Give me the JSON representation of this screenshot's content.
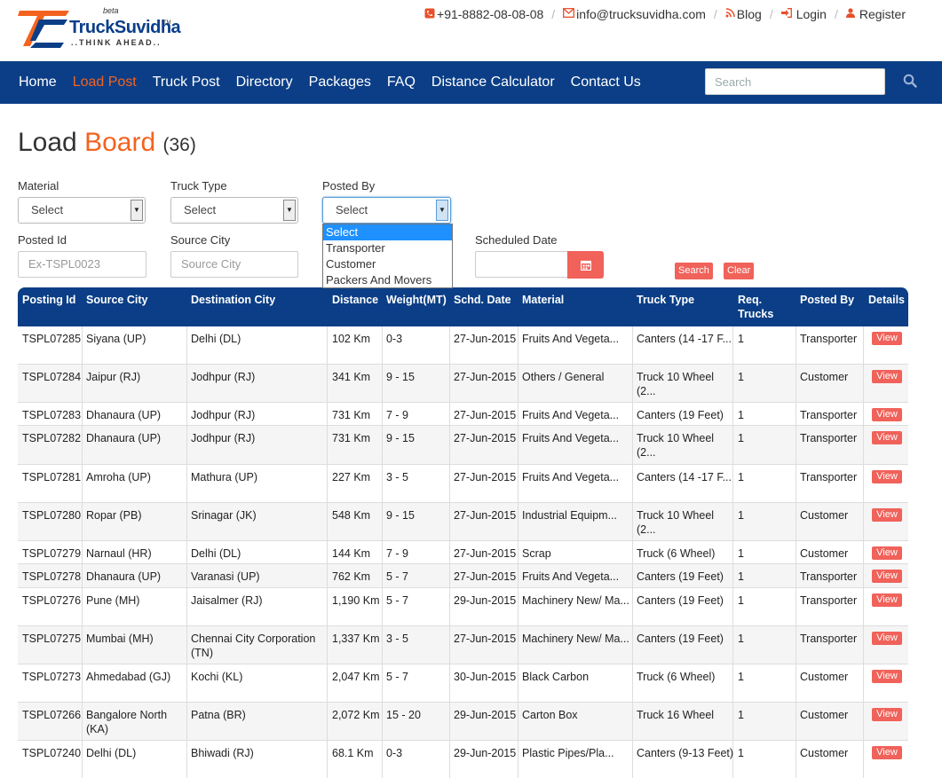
{
  "logo": {
    "brand": "TruckSuvidha",
    "tag": "..THINK AHEAD..",
    "beta": "beta",
    "tm": "TM"
  },
  "contact": {
    "phone": "+91-8882-08-08-08",
    "email": "info@trucksuvidha.com",
    "blog": "Blog",
    "login": "Login",
    "register": "Register"
  },
  "nav": {
    "items": [
      "Home",
      "Load Post",
      "Truck Post",
      "Directory",
      "Packages",
      "FAQ",
      "Distance Calculator",
      "Contact Us"
    ],
    "search_placeholder": "Search"
  },
  "heading": {
    "part1": "Load",
    "part2": "Board",
    "count": "(36)"
  },
  "filters": {
    "material_label": "Material",
    "material_value": "Select",
    "truck_type_label": "Truck Type",
    "truck_type_value": "Select",
    "posted_by_label": "Posted By",
    "posted_by_value": "Select",
    "posted_by_options": [
      "Select",
      "Transporter",
      "Customer",
      "Packers And Movers"
    ],
    "posted_id_label": "Posted Id",
    "posted_id_placeholder": "Ex-TSPL0023",
    "source_city_label": "Source City",
    "source_city_placeholder": "Source City",
    "scheduled_date_label": "Scheduled Date",
    "search_button": "Search",
    "clear_button": "Clear"
  },
  "table": {
    "headers": [
      "Posting Id",
      "Source City",
      "Destination City",
      "Distance",
      "Weight(MT)",
      "Schd. Date",
      "Material",
      "Truck Type",
      "Req. Trucks",
      "Posted By",
      "Details"
    ],
    "view_label": "View",
    "rows": [
      [
        "TSPL07285",
        "Siyana (UP)",
        "Delhi (DL)",
        "102 Km",
        "0-3",
        "27-Jun-2015",
        "Fruits And Vegeta...",
        "Canters (14 -17 F...",
        "1",
        "Transporter"
      ],
      [
        "TSPL07284",
        "Jaipur (RJ)",
        "Jodhpur (RJ)",
        "341 Km",
        "9 - 15",
        "27-Jun-2015",
        "Others / General",
        "Truck 10 Wheel (2...",
        "1",
        "Customer"
      ],
      [
        "TSPL07283",
        "Dhanaura (UP)",
        "Jodhpur (RJ)",
        "731 Km",
        "7 - 9",
        "27-Jun-2015",
        "Fruits And Vegeta...",
        "Canters (19 Feet)",
        "1",
        "Transporter"
      ],
      [
        "TSPL07282",
        "Dhanaura (UP)",
        "Jodhpur (RJ)",
        "731 Km",
        "9 - 15",
        "27-Jun-2015",
        "Fruits And Vegeta...",
        "Truck 10 Wheel (2...",
        "1",
        "Transporter"
      ],
      [
        "TSPL07281",
        "Amroha (UP)",
        "Mathura (UP)",
        "227 Km",
        "3 - 5",
        "27-Jun-2015",
        "Fruits And Vegeta...",
        "Canters (14 -17 F...",
        "1",
        "Transporter"
      ],
      [
        "TSPL07280",
        "Ropar (PB)",
        "Srinagar (JK)",
        "548 Km",
        "9 - 15",
        "27-Jun-2015",
        "Industrial Equipm...",
        "Truck 10 Wheel (2...",
        "1",
        "Customer"
      ],
      [
        "TSPL07279",
        "Narnaul (HR)",
        "Delhi (DL)",
        "144 Km",
        "7 - 9",
        "27-Jun-2015",
        "Scrap",
        "Truck (6 Wheel)",
        "1",
        "Customer"
      ],
      [
        "TSPL07278",
        "Dhanaura (UP)",
        "Varanasi (UP)",
        "762 Km",
        "5 - 7",
        "27-Jun-2015",
        "Fruits And Vegeta...",
        "Canters (19 Feet)",
        "1",
        "Transporter"
      ],
      [
        "TSPL07276",
        "Pune (MH)",
        "Jaisalmer (RJ)",
        "1,190 Km",
        "5 - 7",
        "29-Jun-2015",
        "Machinery New/ Ma...",
        "Canters (19 Feet)",
        "1",
        "Transporter"
      ],
      [
        "TSPL07275",
        "Mumbai (MH)",
        "Chennai City Corporation (TN)",
        "1,337 Km",
        "3 - 5",
        "27-Jun-2015",
        "Machinery New/ Ma...",
        "Canters (19 Feet)",
        "1",
        "Transporter"
      ],
      [
        "TSPL07273",
        "Ahmedabad (GJ)",
        "Kochi (KL)",
        "2,047 Km",
        "5 - 7",
        "30-Jun-2015",
        "Black Carbon",
        "Truck (6 Wheel)",
        "1",
        "Customer"
      ],
      [
        "TSPL07266",
        "Bangalore North (KA)",
        "Patna (BR)",
        "2,072 Km",
        "15 - 20",
        "29-Jun-2015",
        "Carton Box",
        "Truck 16 Wheel",
        "1",
        "Customer"
      ],
      [
        "TSPL07240",
        "Delhi (DL)",
        "Bhiwadi (RJ)",
        "68.1 Km",
        "0-3",
        "29-Jun-2015",
        "Plastic Pipes/Pla...",
        "Canters (9-13 Feet)",
        "1",
        "Customer"
      ]
    ]
  }
}
